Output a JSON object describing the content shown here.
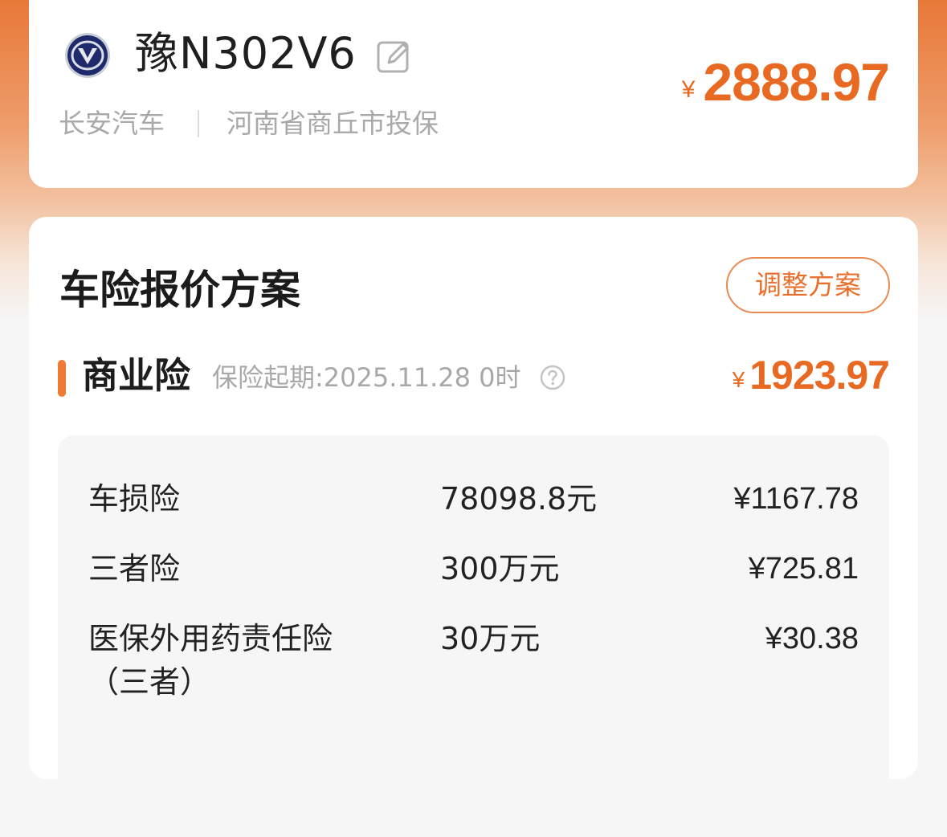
{
  "vehicle": {
    "plate": "豫N302V6",
    "brand": "长安汽车",
    "region": "河南省商丘市投保",
    "currency_symbol": "¥",
    "total_price": "2888.97",
    "logo_icon": "changan-logo-icon",
    "edit_icon": "edit-pencil-icon"
  },
  "quote": {
    "title": "车险报价方案",
    "adjust_label": "调整方案",
    "commercial": {
      "title": "商业险",
      "start_date": "保险起期:2025.11.28 0时",
      "help_icon": "question-circle-icon",
      "currency_symbol": "¥",
      "price": "1923.97",
      "items": [
        {
          "name": "车损险",
          "amount": "78098.8元",
          "price": "¥1167.78"
        },
        {
          "name": "三者险",
          "amount": "300万元",
          "price": "¥725.81"
        },
        {
          "name": "医保外用药责任险（三者）",
          "amount": "30万元",
          "price": "¥30.38"
        }
      ]
    }
  },
  "colors": {
    "accent": "#e86a22",
    "header_gradient_top": "#e87838"
  }
}
